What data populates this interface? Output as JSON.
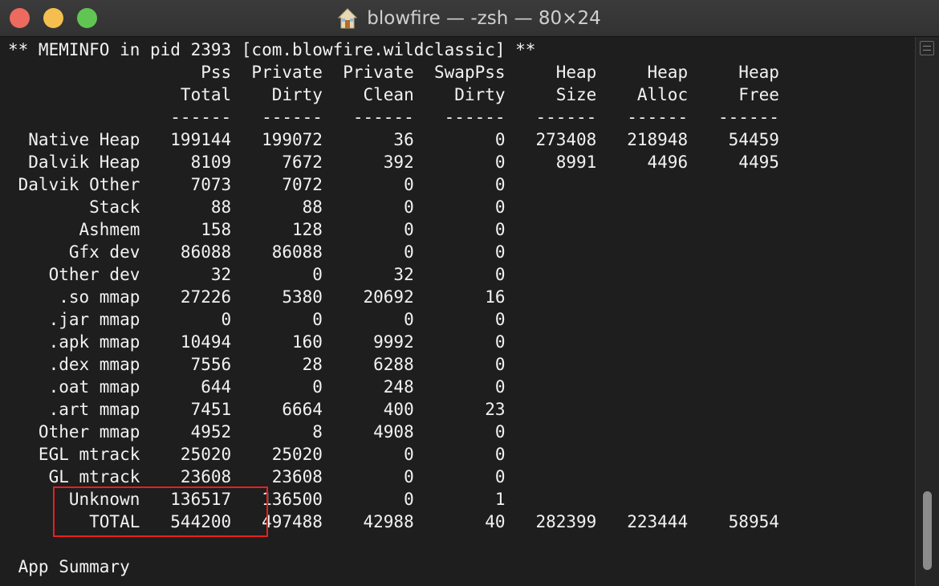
{
  "window": {
    "title": "blowfire — -zsh — 80×24",
    "icon": "home-folder-icon"
  },
  "terminal": {
    "lines": [
      "** MEMINFO in pid 2393 [com.blowfire.wildclassic] **",
      "                   Pss  Private  Private  SwapPss     Heap     Heap     Heap",
      "                 Total    Dirty    Clean    Dirty     Size    Alloc     Free",
      "                ------   ------   ------   ------   ------   ------   ------",
      "  Native Heap   199144   199072       36        0   273408   218948    54459",
      "  Dalvik Heap     8109     7672      392        0     8991     4496     4495",
      " Dalvik Other     7073     7072        0        0",
      "        Stack       88       88        0        0",
      "       Ashmem      158      128        0        0",
      "      Gfx dev    86088    86088        0        0",
      "    Other dev       32        0       32        0",
      "     .so mmap    27226     5380    20692       16",
      "    .jar mmap        0        0        0        0",
      "    .apk mmap    10494      160     9992        0",
      "    .dex mmap     7556       28     6288        0",
      "    .oat mmap      644        0      248        0",
      "    .art mmap     7451     6664      400       23",
      "   Other mmap     4952        8     4908        0",
      "   EGL mtrack    25020    25020        0        0",
      "    GL mtrack    23608    23608        0        0",
      "      Unknown   136517   136500        0        1",
      "        TOTAL   544200   497488    42988       40   282399   223444    58954",
      "",
      " App Summary"
    ]
  },
  "colors": {
    "background": "#1e1e1e",
    "text": "#f2f2f2",
    "highlight_box": "#e8201e"
  }
}
